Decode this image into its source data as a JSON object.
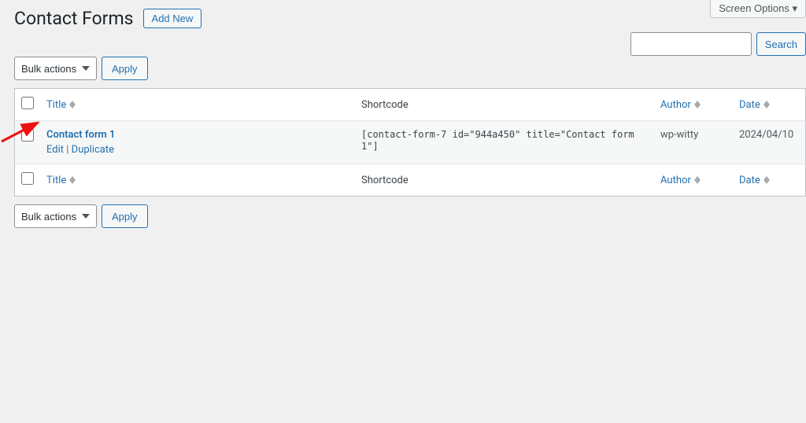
{
  "screenOptions": {
    "label": "Screen Options ▾"
  },
  "search": {
    "placeholder": "",
    "button": "Search"
  },
  "header": {
    "title": "Contact Forms",
    "addNew": "Add New"
  },
  "bulk": {
    "selected": "Bulk actions",
    "apply": "Apply"
  },
  "columns": {
    "title": "Title",
    "shortcode": "Shortcode",
    "author": "Author",
    "date": "Date"
  },
  "rows": [
    {
      "title": "Contact form 1",
      "actions": {
        "edit": "Edit",
        "duplicate": "Duplicate"
      },
      "shortcode": "[contact-form-7 id=\"944a450\" title=\"Contact form 1\"]",
      "author": "wp-witty",
      "date": "2024/04/10"
    }
  ]
}
